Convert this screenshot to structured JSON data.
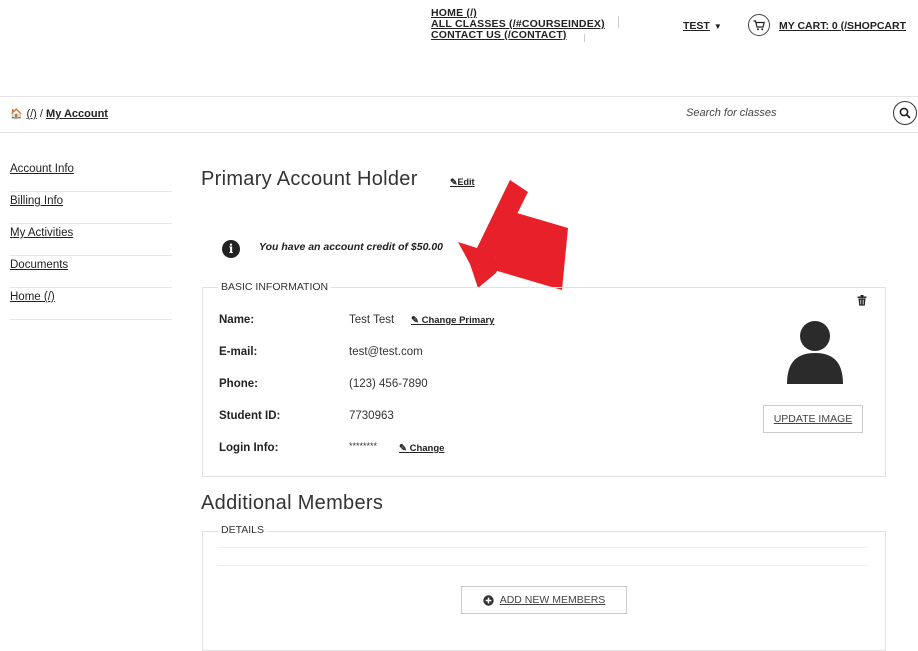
{
  "nav": {
    "home": "HOME (/)",
    "all_classes": "ALL CLASSES (/#COURSEINDEX)",
    "contact": "CONTACT US (/CONTACT)",
    "user": "TEST",
    "cart": "MY CART: 0 (/SHOPCART"
  },
  "breadcrumb": {
    "root": "(/)",
    "sep": "/",
    "current": "My Account"
  },
  "search": {
    "placeholder": "Search for classes"
  },
  "sidebar": {
    "items": [
      {
        "label": "Account Info"
      },
      {
        "label": "Billing Info"
      },
      {
        "label": "My Activities"
      },
      {
        "label": "Documents"
      },
      {
        "label": "Home (/)"
      }
    ]
  },
  "primary": {
    "title": "Primary Account Holder",
    "edit_label": "Edit",
    "credit_message": "You have an account credit of $50.00"
  },
  "basic_info": {
    "legend": "BASIC INFORMATION",
    "rows": [
      {
        "label": "Name:",
        "value": "Test Test",
        "link": "Change Primary"
      },
      {
        "label": "E-mail:",
        "value": "test@test.com"
      },
      {
        "label": "Phone:",
        "value": "(123) 456-7890"
      },
      {
        "label": "Student ID:",
        "value": "7730963"
      },
      {
        "label": "Login Info:",
        "value": "********",
        "link": "Change"
      }
    ],
    "update_image_label": "UPDATE IMAGE"
  },
  "additional": {
    "title": "Additional Members",
    "legend": "DETAILS",
    "add_label": "ADD NEW MEMBERS"
  },
  "colors": {
    "annotation_arrow": "#e8202a",
    "text": "#222222"
  }
}
